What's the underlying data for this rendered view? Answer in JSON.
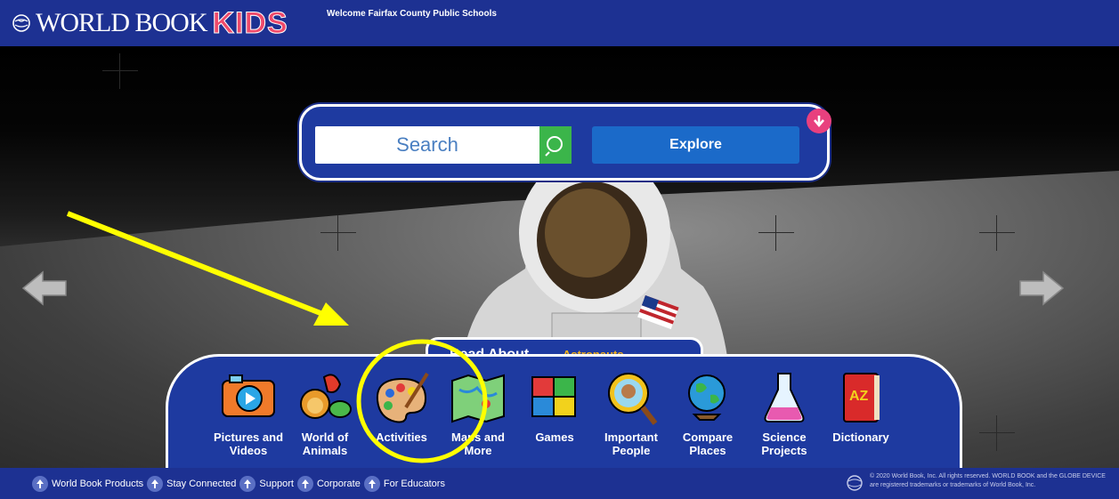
{
  "header": {
    "logo_text": "WORLD BOOK",
    "logo_kids": "KIDS",
    "welcome": "Welcome Fairfax County Public Schools"
  },
  "search": {
    "placeholder": "Search",
    "explore_label": "Explore"
  },
  "read_about": {
    "label": "Read About...",
    "topic": "Astronauts"
  },
  "nav": {
    "items": [
      {
        "label": "Pictures and Videos",
        "icon": "camera-icon"
      },
      {
        "label": "World of Animals",
        "icon": "animals-icon"
      },
      {
        "label": "Activities",
        "icon": "palette-icon"
      },
      {
        "label": "Maps and More",
        "icon": "map-icon"
      },
      {
        "label": "Games",
        "icon": "puzzle-icon"
      },
      {
        "label": "Important People",
        "icon": "magnifier-person-icon"
      },
      {
        "label": "Compare Places",
        "icon": "globe-icon"
      },
      {
        "label": "Science Projects",
        "icon": "flask-icon"
      },
      {
        "label": "Dictionary",
        "icon": "book-az-icon"
      }
    ]
  },
  "footer": {
    "links": [
      "World Book Products",
      "Stay Connected",
      "Support",
      "Corporate",
      "For Educators"
    ],
    "copyright": "© 2020 World Book, Inc. All rights reserved. WORLD BOOK and the GLOBE DEVICE are registered trademarks or trademarks of World Book, Inc."
  },
  "colors": {
    "header_bg": "#1d3192",
    "panel_bg": "#1e3aa0",
    "search_green": "#3bb54a",
    "explore_blue": "#1b6ac9",
    "kids_pink": "#ef4a6b",
    "topic_gold": "#f2b11c",
    "annotation_yellow": "#ffff00"
  }
}
